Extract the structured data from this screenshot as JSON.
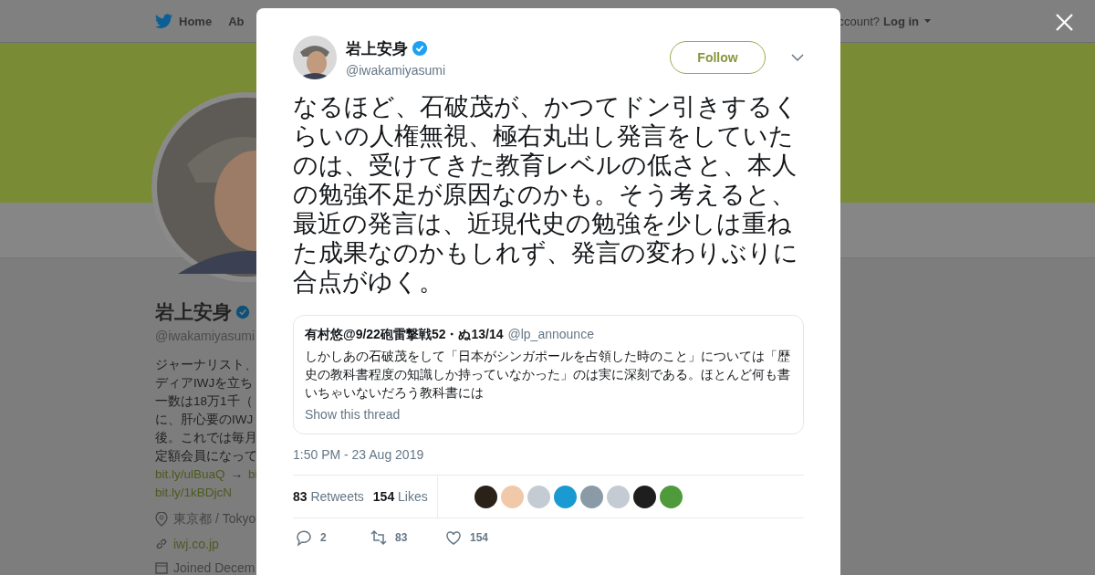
{
  "header": {
    "home": "Home",
    "about": "Ab",
    "account": "ccount?",
    "login": "Log in"
  },
  "profile": {
    "name": "岩上安身",
    "handle": "@iwakamiyasumi",
    "verified": true,
    "bio_lines": [
      "ジャーナリスト、",
      "ディアIWJを立ち",
      "一数は18万1千（",
      "に、肝心要のIWJ",
      "後。これでは毎月",
      "定額会員になって"
    ],
    "links": [
      {
        "text": "bit.ly/ulBuaQ",
        "arrow": "→",
        "extra": "bi"
      },
      {
        "text": "bit.ly/1kBDjcN"
      }
    ],
    "location": "東京都 / Tokyo",
    "website": "iwj.co.jp",
    "joined": "Joined Decem"
  },
  "tweet": {
    "name": "岩上安身",
    "handle": "@iwakamiyasumi",
    "verified": true,
    "follow": "Follow",
    "text": "なるほど、石破茂が、かつてドン引きするくらいの人権無視、極右丸出し発言をしていたのは、受けてきた教育レベルの低さと、本人の勉強不足が原因なのかも。そう考えると、最近の発言は、近現代史の勉強を少しは重ねた成果なのかもしれず、発言の変わりぶりに合点がゆく。",
    "quote": {
      "name": "有村悠@9/22砲雷撃戦52・ぬ13/14",
      "handle": "@lp_announce",
      "text": "しかしあの石破茂をして「日本がシンガポールを占領した時のこと」については「歴史の教科書程度の知識しか持っていなかった」のは実に深刻である。ほとんど何も書いちゃいないだろう教科書には",
      "more": "Show this thread"
    },
    "time": "1:50 PM - 23 Aug 2019",
    "retweets": {
      "count": "83",
      "label": "Retweets"
    },
    "likes": {
      "count": "154",
      "label": "Likes"
    },
    "likers": [
      {
        "color": "#2a2118"
      },
      {
        "color": "#f2c9a8"
      },
      {
        "color": "#c4cbd2"
      },
      {
        "color": "#1a9ad0"
      },
      {
        "color": "#8a9aa6"
      },
      {
        "color": "#c4cbd2"
      },
      {
        "color": "#1e1e1e"
      },
      {
        "color": "#4f9a3a"
      }
    ],
    "actions": [
      {
        "kind": "reply",
        "count": "2"
      },
      {
        "kind": "retweet",
        "count": "83"
      },
      {
        "kind": "like",
        "count": "154"
      }
    ]
  }
}
